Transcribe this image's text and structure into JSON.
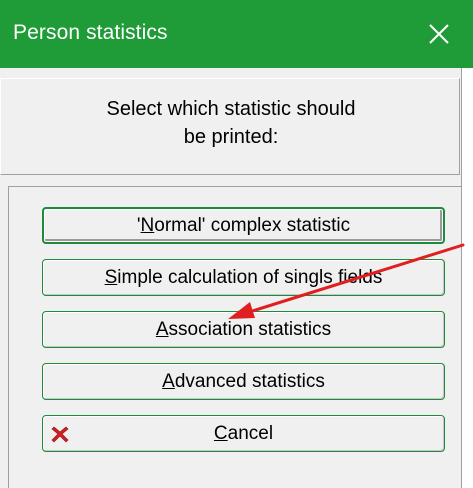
{
  "window": {
    "title": "Person statistics",
    "close_glyph": "✕",
    "titlebar_color": "#1f9b37"
  },
  "prompt": {
    "line1": "Select which statistic should",
    "line2": "be printed:"
  },
  "buttons": {
    "normal": {
      "accel": "N",
      "pre": "'",
      "post": "ormal' complex statistic"
    },
    "simple": {
      "accel": "S",
      "post": "imple calculation of singls fields"
    },
    "association": {
      "accel": "A",
      "post": "ssociation statistics"
    },
    "advanced": {
      "pre": "",
      "accel": "A",
      "post": "dvanced statistics"
    },
    "cancel": {
      "accel": "C",
      "post": "ancel",
      "icon": "red-x-icon"
    }
  },
  "annotation": {
    "arrow_color": "#e02020",
    "icon": "red-arrow-annotation"
  }
}
